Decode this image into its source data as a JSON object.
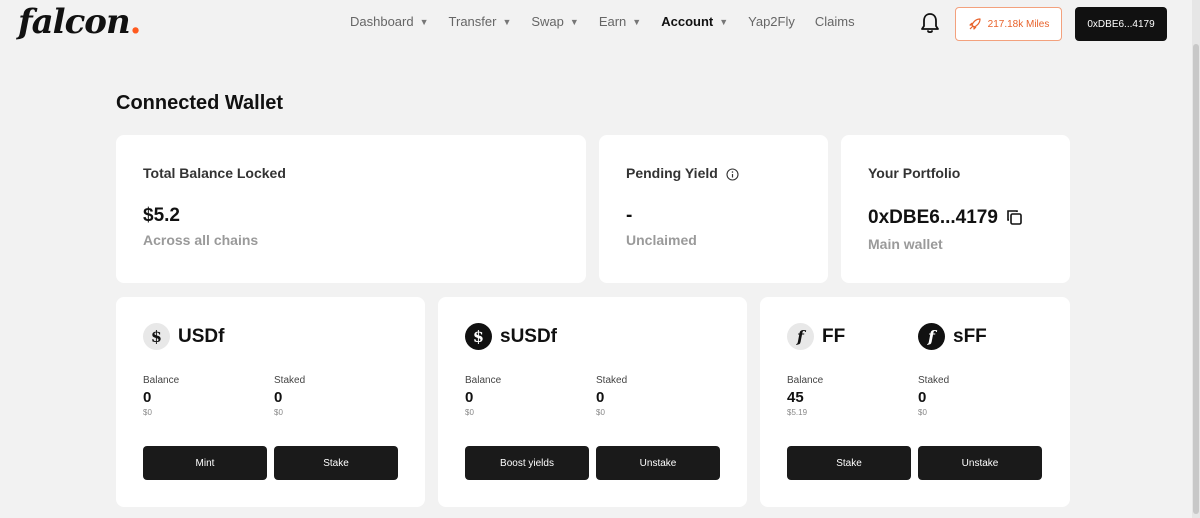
{
  "header": {
    "logo_text": "falcon",
    "logo_dot": ".",
    "nav": [
      {
        "label": "Dashboard",
        "has_dropdown": true
      },
      {
        "label": "Transfer",
        "has_dropdown": true
      },
      {
        "label": "Swap",
        "has_dropdown": true
      },
      {
        "label": "Earn",
        "has_dropdown": true
      },
      {
        "label": "Account",
        "has_dropdown": true,
        "active": true
      },
      {
        "label": "Yap2Fly",
        "has_dropdown": false
      },
      {
        "label": "Claims",
        "has_dropdown": false
      }
    ],
    "miles_label": "217.18k Miles",
    "wallet_label": "0xDBE6...4179",
    "chevron": "⌄"
  },
  "page": {
    "title": "Connected Wallet"
  },
  "summary": {
    "tvl": {
      "label": "Total Balance Locked",
      "value": "$5.2",
      "sub": "Across all chains"
    },
    "yield": {
      "label": "Pending Yield",
      "value": "-",
      "sub": "Unclaimed"
    },
    "portfolio": {
      "label": "Your Portfolio",
      "value": "0xDBE6...4179",
      "sub": "Main wallet"
    }
  },
  "tokens": {
    "usdf": {
      "name": "USDf",
      "icon": "$",
      "balance_label": "Balance",
      "balance": "0",
      "balance_usd": "$0",
      "staked_label": "Staked",
      "staked": "0",
      "staked_usd": "$0",
      "btn1": "Mint",
      "btn2": "Stake"
    },
    "susdf": {
      "name": "sUSDf",
      "icon": "$",
      "balance_label": "Balance",
      "balance": "0",
      "balance_usd": "$0",
      "staked_label": "Staked",
      "staked": "0",
      "staked_usd": "$0",
      "btn1": "Boost yields",
      "btn2": "Unstake"
    },
    "ff": {
      "name": "FF",
      "icon": "f",
      "sff_name": "sFF",
      "sff_icon": "f",
      "balance_label": "Balance",
      "balance": "45",
      "balance_usd": "$5.19",
      "staked_label": "Staked",
      "staked": "0",
      "staked_usd": "$0",
      "btn1": "Stake",
      "btn2": "Unstake"
    }
  },
  "colors": {
    "accent": "#ff5a1f",
    "dark": "#111111",
    "background": "#f2f2f2"
  }
}
